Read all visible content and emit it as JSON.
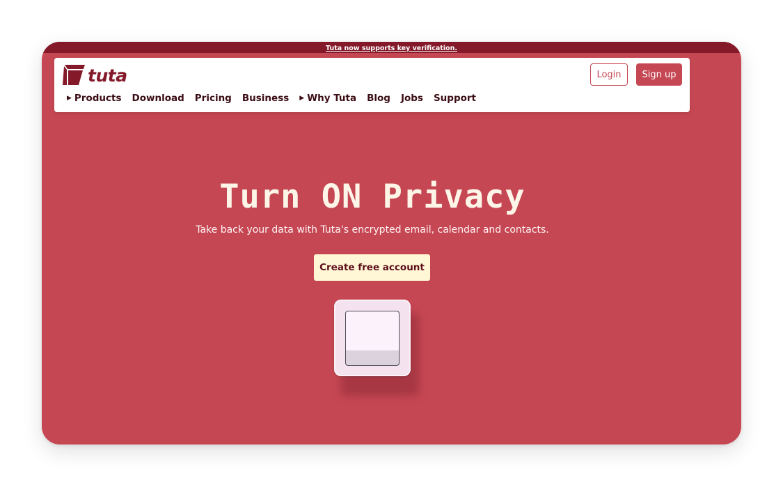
{
  "announcement": {
    "text": "Tuta now supports key verification."
  },
  "brand": {
    "name": "tuta",
    "color": "#84192a",
    "icon": "tuta-logo-icon"
  },
  "header": {
    "login_label": "Login",
    "signup_label": "Sign up"
  },
  "nav": {
    "items": [
      {
        "label": "Products",
        "has_caret": true
      },
      {
        "label": "Download",
        "has_caret": false
      },
      {
        "label": "Pricing",
        "has_caret": false
      },
      {
        "label": "Business",
        "has_caret": false
      },
      {
        "label": "Why Tuta",
        "has_caret": true
      },
      {
        "label": "Blog",
        "has_caret": false
      },
      {
        "label": "Jobs",
        "has_caret": false
      },
      {
        "label": "Support",
        "has_caret": false
      }
    ],
    "caret_glyph": "▶"
  },
  "hero": {
    "title": "Turn ON Privacy",
    "subtitle": "Take back your data with Tuta's encrypted email, calendar and contacts.",
    "cta_label": "Create free account",
    "illustration": "light-switch-icon"
  },
  "colors": {
    "background": "#c54753",
    "banner": "#84192a",
    "cta_background": "#fff7d6",
    "cta_text": "#5c0f1b"
  }
}
